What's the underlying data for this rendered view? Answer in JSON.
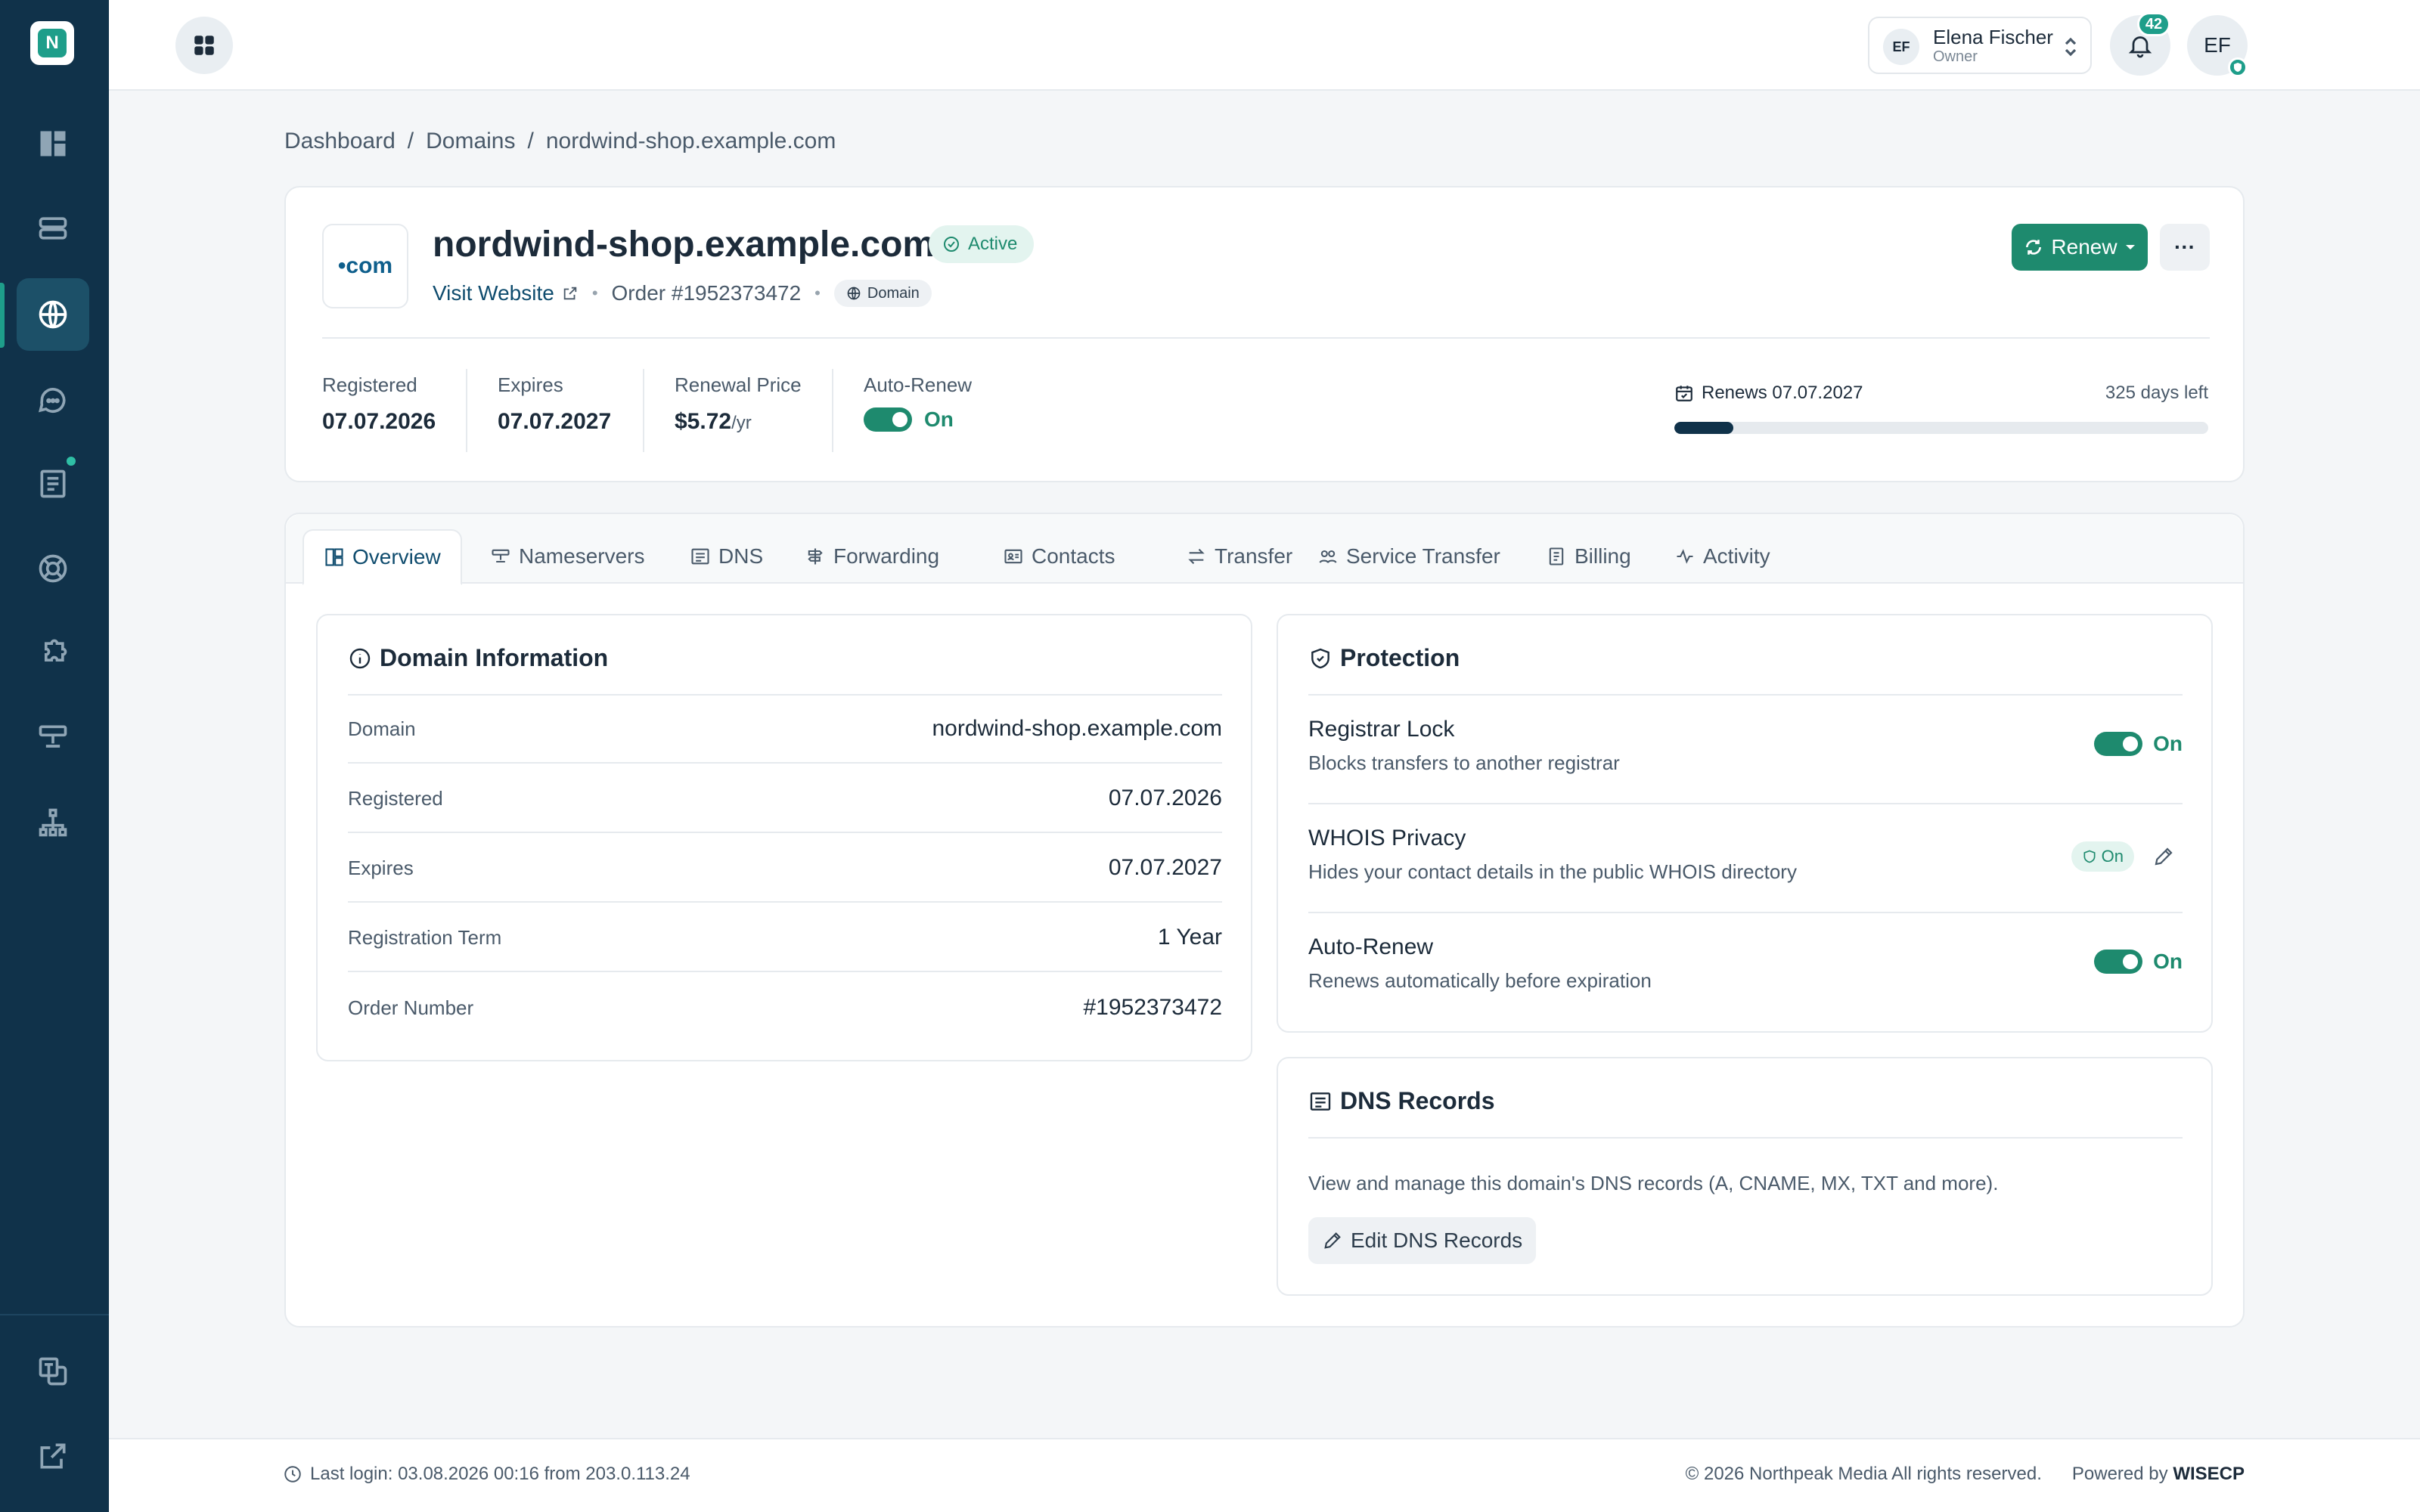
{
  "app": {
    "logo_letter": "N"
  },
  "topbar": {
    "user_initials_small": "EF",
    "user_name": "Elena Fischer",
    "user_role": "Owner",
    "notifications_count": "42",
    "avatar_initials": "EF"
  },
  "breadcrumb": {
    "items": [
      "Dashboard",
      "Domains",
      "nordwind-shop.example.com"
    ],
    "separator": "/"
  },
  "domain": {
    "tld_label": "•com",
    "name": "nordwind-shop.example.com",
    "status": "Active",
    "visit_label": "Visit Website",
    "order_label": "Order #1952373472",
    "type_pill": "Domain",
    "renew_label": "Renew",
    "more_label": "···",
    "stats": {
      "registered_label": "Registered",
      "registered_value": "07.07.2026",
      "expires_label": "Expires",
      "expires_value": "07.07.2027",
      "price_label": "Renewal Price",
      "price_value": "$5.72",
      "price_unit": "/yr",
      "autorenew_label": "Auto-Renew",
      "autorenew_value": "On"
    },
    "renews_label": "Renews 07.07.2027",
    "days_left": "325 days left",
    "renew_progress_fraction": 0.11
  },
  "tabs": [
    {
      "label": "Overview",
      "icon": "overview-icon",
      "active": true
    },
    {
      "label": "Nameservers",
      "icon": "nameservers-icon"
    },
    {
      "label": "DNS",
      "icon": "dns-icon"
    },
    {
      "label": "Forwarding",
      "icon": "forwarding-icon"
    },
    {
      "label": "Contacts",
      "icon": "contacts-icon"
    },
    {
      "label": "Transfer",
      "icon": "transfer-icon"
    },
    {
      "label": "Service Transfer",
      "icon": "service-transfer-icon"
    },
    {
      "label": "Billing",
      "icon": "billing-icon"
    },
    {
      "label": "Activity",
      "icon": "activity-icon"
    }
  ],
  "domain_info": {
    "title": "Domain Information",
    "rows": [
      {
        "key": "Domain",
        "value": "nordwind-shop.example.com"
      },
      {
        "key": "Registered",
        "value": "07.07.2026"
      },
      {
        "key": "Expires",
        "value": "07.07.2027"
      },
      {
        "key": "Registration Term",
        "value": "1 Year"
      },
      {
        "key": "Order Number",
        "value": "#1952373472"
      }
    ]
  },
  "protection": {
    "title": "Protection",
    "rows": [
      {
        "title": "Registrar Lock",
        "desc": "Blocks transfers to another registrar",
        "state": "On"
      },
      {
        "title": "WHOIS Privacy",
        "desc": "Hides your contact details in the public WHOIS directory",
        "state": "On"
      },
      {
        "title": "Auto-Renew",
        "desc": "Renews automatically before expiration",
        "state": "On"
      }
    ]
  },
  "dns_records": {
    "title": "DNS Records",
    "desc": "View and manage this domain's DNS records (A, CNAME, MX, TXT and more).",
    "button": "Edit DNS Records"
  },
  "footer": {
    "last_login": "Last login: 03.08.2026 00:16 from 203.0.113.24",
    "copyright": "© 2026 Northpeak Media All rights reserved.",
    "powered_prefix": "Powered by",
    "powered_brand": "WISECP"
  },
  "colors": {
    "sidebar": "#10324a",
    "accent": "#1e8a6e",
    "brand_teal": "#1e9e8a"
  }
}
